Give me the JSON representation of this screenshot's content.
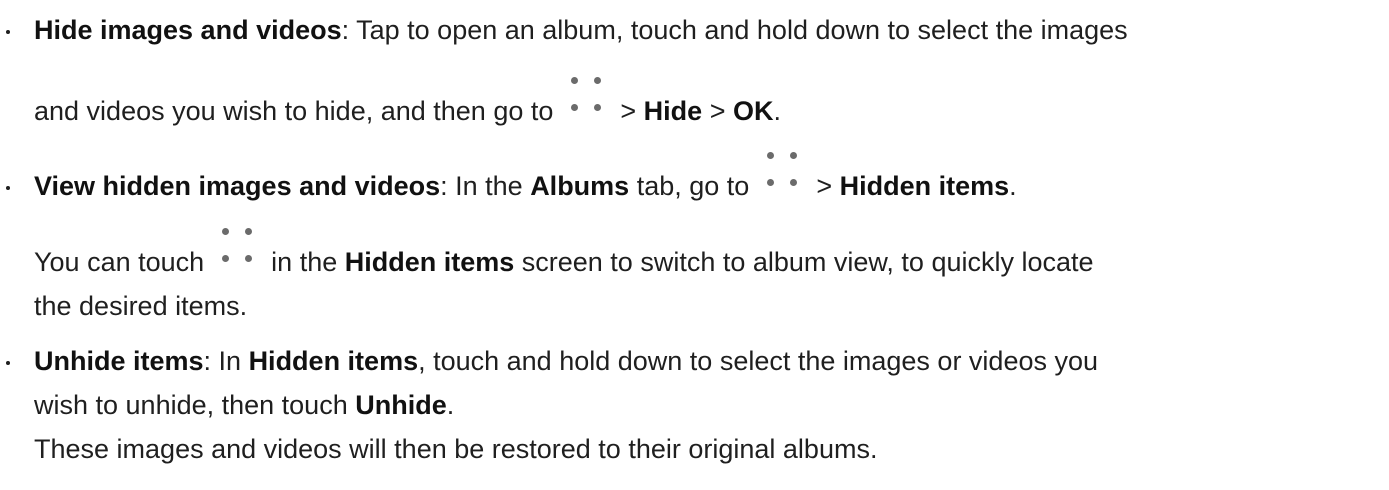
{
  "items": [
    {
      "title": "Hide images and videos",
      "line1_text": ": Tap to open an album, touch and hold down to select the images",
      "line2_text": "and videos you wish to hide, and then go to",
      "line2_sep1": " > ",
      "line2_bold1": "Hide",
      "line2_sep2": " > ",
      "line2_bold2": "OK",
      "line2_end": "."
    },
    {
      "title": "View hidden images and videos",
      "line1_a": ": In the ",
      "line1_bold": "Albums",
      "line1_b": " tab, go to",
      "line1_sep": " > ",
      "line1_bold2": "Hidden items",
      "line1_end": ".",
      "line2_a": "You can touch",
      "line2_b": " in the ",
      "line2_bold": "Hidden items",
      "line2_c": " screen to switch to album view, to quickly locate",
      "line3": "the desired items."
    },
    {
      "title": "Unhide items",
      "line1_a": ": In ",
      "line1_bold": "Hidden items",
      "line1_b": ", touch and hold down to select the images or videos you",
      "line2_a": "wish to unhide, then touch ",
      "line2_bold": "Unhide",
      "line2_end": ".",
      "line3": "These images and videos will then be restored to their original albums."
    }
  ],
  "icons": {
    "more_icon": "four-dot-more-icon"
  }
}
